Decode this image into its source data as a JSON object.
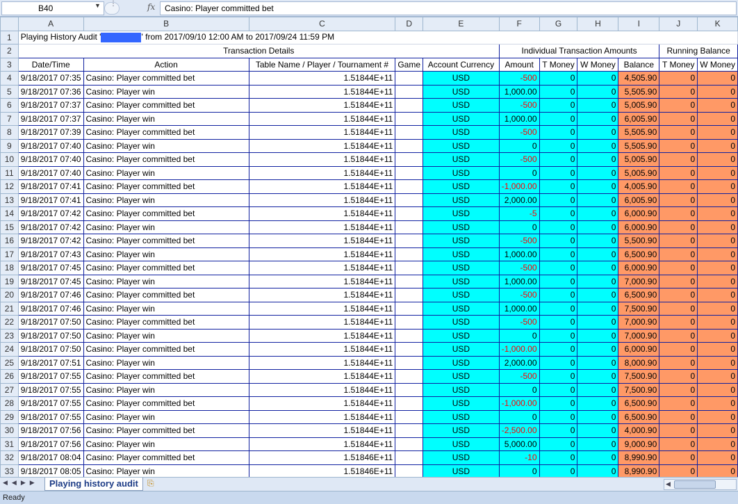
{
  "formula_bar": {
    "name_box": "B40",
    "fx_label": "fx",
    "formula": "Casino: Player committed bet"
  },
  "columns": [
    "A",
    "B",
    "C",
    "D",
    "E",
    "F",
    "G",
    "H",
    "I",
    "J",
    "K"
  ],
  "title": {
    "row": "1",
    "prefix": "Playing History Audit '",
    "suffix": "' from 2017/09/10 12:00 AM to 2017/09/24 11:59 PM"
  },
  "group_headers": {
    "row": "2",
    "transaction_details": "Transaction Details",
    "individual_amounts": "Individual Transaction Amounts",
    "running_balance": "Running Balance"
  },
  "column_headers": {
    "row": "3",
    "date_time": "Date/Time",
    "action": "Action",
    "table_name": "Table Name / Player / Tournament #",
    "game": "Game",
    "account_currency": "Account Currency",
    "amount": "Amount",
    "t_money": "T Money",
    "w_money": "W Money",
    "balance": "Balance",
    "rb_t_money": "T Money",
    "rb_w_money": "W Money"
  },
  "rows": [
    {
      "row": "4",
      "dt": "9/18/2017 07:35",
      "action": "Casino: Player committed bet",
      "table": "1.51844E+11",
      "cur": "USD",
      "amount": "-500",
      "t": "0",
      "w": "0",
      "bal": "4,505.90",
      "bt": "0",
      "bw": "0"
    },
    {
      "row": "5",
      "dt": "9/18/2017 07:36",
      "action": "Casino: Player win",
      "table": "1.51844E+11",
      "cur": "USD",
      "amount": "1,000.00",
      "t": "0",
      "w": "0",
      "bal": "5,505.90",
      "bt": "0",
      "bw": "0"
    },
    {
      "row": "6",
      "dt": "9/18/2017 07:37",
      "action": "Casino: Player committed bet",
      "table": "1.51844E+11",
      "cur": "USD",
      "amount": "-500",
      "t": "0",
      "w": "0",
      "bal": "5,005.90",
      "bt": "0",
      "bw": "0"
    },
    {
      "row": "7",
      "dt": "9/18/2017 07:37",
      "action": "Casino: Player win",
      "table": "1.51844E+11",
      "cur": "USD",
      "amount": "1,000.00",
      "t": "0",
      "w": "0",
      "bal": "6,005.90",
      "bt": "0",
      "bw": "0"
    },
    {
      "row": "8",
      "dt": "9/18/2017 07:39",
      "action": "Casino: Player committed bet",
      "table": "1.51844E+11",
      "cur": "USD",
      "amount": "-500",
      "t": "0",
      "w": "0",
      "bal": "5,505.90",
      "bt": "0",
      "bw": "0"
    },
    {
      "row": "9",
      "dt": "9/18/2017 07:40",
      "action": "Casino: Player win",
      "table": "1.51844E+11",
      "cur": "USD",
      "amount": "0",
      "t": "0",
      "w": "0",
      "bal": "5,505.90",
      "bt": "0",
      "bw": "0"
    },
    {
      "row": "10",
      "dt": "9/18/2017 07:40",
      "action": "Casino: Player committed bet",
      "table": "1.51844E+11",
      "cur": "USD",
      "amount": "-500",
      "t": "0",
      "w": "0",
      "bal": "5,005.90",
      "bt": "0",
      "bw": "0"
    },
    {
      "row": "11",
      "dt": "9/18/2017 07:40",
      "action": "Casino: Player win",
      "table": "1.51844E+11",
      "cur": "USD",
      "amount": "0",
      "t": "0",
      "w": "0",
      "bal": "5,005.90",
      "bt": "0",
      "bw": "0"
    },
    {
      "row": "12",
      "dt": "9/18/2017 07:41",
      "action": "Casino: Player committed bet",
      "table": "1.51844E+11",
      "cur": "USD",
      "amount": "-1,000.00",
      "t": "0",
      "w": "0",
      "bal": "4,005.90",
      "bt": "0",
      "bw": "0"
    },
    {
      "row": "13",
      "dt": "9/18/2017 07:41",
      "action": "Casino: Player win",
      "table": "1.51844E+11",
      "cur": "USD",
      "amount": "2,000.00",
      "t": "0",
      "w": "0",
      "bal": "6,005.90",
      "bt": "0",
      "bw": "0"
    },
    {
      "row": "14",
      "dt": "9/18/2017 07:42",
      "action": "Casino: Player committed bet",
      "table": "1.51844E+11",
      "cur": "USD",
      "amount": "-5",
      "t": "0",
      "w": "0",
      "bal": "6,000.90",
      "bt": "0",
      "bw": "0"
    },
    {
      "row": "15",
      "dt": "9/18/2017 07:42",
      "action": "Casino: Player win",
      "table": "1.51844E+11",
      "cur": "USD",
      "amount": "0",
      "t": "0",
      "w": "0",
      "bal": "6,000.90",
      "bt": "0",
      "bw": "0"
    },
    {
      "row": "16",
      "dt": "9/18/2017 07:42",
      "action": "Casino: Player committed bet",
      "table": "1.51844E+11",
      "cur": "USD",
      "amount": "-500",
      "t": "0",
      "w": "0",
      "bal": "5,500.90",
      "bt": "0",
      "bw": "0"
    },
    {
      "row": "17",
      "dt": "9/18/2017 07:43",
      "action": "Casino: Player win",
      "table": "1.51844E+11",
      "cur": "USD",
      "amount": "1,000.00",
      "t": "0",
      "w": "0",
      "bal": "6,500.90",
      "bt": "0",
      "bw": "0"
    },
    {
      "row": "18",
      "dt": "9/18/2017 07:45",
      "action": "Casino: Player committed bet",
      "table": "1.51844E+11",
      "cur": "USD",
      "amount": "-500",
      "t": "0",
      "w": "0",
      "bal": "6,000.90",
      "bt": "0",
      "bw": "0"
    },
    {
      "row": "19",
      "dt": "9/18/2017 07:45",
      "action": "Casino: Player win",
      "table": "1.51844E+11",
      "cur": "USD",
      "amount": "1,000.00",
      "t": "0",
      "w": "0",
      "bal": "7,000.90",
      "bt": "0",
      "bw": "0"
    },
    {
      "row": "20",
      "dt": "9/18/2017 07:46",
      "action": "Casino: Player committed bet",
      "table": "1.51844E+11",
      "cur": "USD",
      "amount": "-500",
      "t": "0",
      "w": "0",
      "bal": "6,500.90",
      "bt": "0",
      "bw": "0"
    },
    {
      "row": "21",
      "dt": "9/18/2017 07:46",
      "action": "Casino: Player win",
      "table": "1.51844E+11",
      "cur": "USD",
      "amount": "1,000.00",
      "t": "0",
      "w": "0",
      "bal": "7,500.90",
      "bt": "0",
      "bw": "0"
    },
    {
      "row": "22",
      "dt": "9/18/2017 07:50",
      "action": "Casino: Player committed bet",
      "table": "1.51844E+11",
      "cur": "USD",
      "amount": "-500",
      "t": "0",
      "w": "0",
      "bal": "7,000.90",
      "bt": "0",
      "bw": "0"
    },
    {
      "row": "23",
      "dt": "9/18/2017 07:50",
      "action": "Casino: Player win",
      "table": "1.51844E+11",
      "cur": "USD",
      "amount": "0",
      "t": "0",
      "w": "0",
      "bal": "7,000.90",
      "bt": "0",
      "bw": "0"
    },
    {
      "row": "24",
      "dt": "9/18/2017 07:50",
      "action": "Casino: Player committed bet",
      "table": "1.51844E+11",
      "cur": "USD",
      "amount": "-1,000.00",
      "t": "0",
      "w": "0",
      "bal": "6,000.90",
      "bt": "0",
      "bw": "0"
    },
    {
      "row": "25",
      "dt": "9/18/2017 07:51",
      "action": "Casino: Player win",
      "table": "1.51844E+11",
      "cur": "USD",
      "amount": "2,000.00",
      "t": "0",
      "w": "0",
      "bal": "8,000.90",
      "bt": "0",
      "bw": "0"
    },
    {
      "row": "26",
      "dt": "9/18/2017 07:55",
      "action": "Casino: Player committed bet",
      "table": "1.51844E+11",
      "cur": "USD",
      "amount": "-500",
      "t": "0",
      "w": "0",
      "bal": "7,500.90",
      "bt": "0",
      "bw": "0"
    },
    {
      "row": "27",
      "dt": "9/18/2017 07:55",
      "action": "Casino: Player win",
      "table": "1.51844E+11",
      "cur": "USD",
      "amount": "0",
      "t": "0",
      "w": "0",
      "bal": "7,500.90",
      "bt": "0",
      "bw": "0"
    },
    {
      "row": "28",
      "dt": "9/18/2017 07:55",
      "action": "Casino: Player committed bet",
      "table": "1.51844E+11",
      "cur": "USD",
      "amount": "-1,000.00",
      "t": "0",
      "w": "0",
      "bal": "6,500.90",
      "bt": "0",
      "bw": "0"
    },
    {
      "row": "29",
      "dt": "9/18/2017 07:55",
      "action": "Casino: Player win",
      "table": "1.51844E+11",
      "cur": "USD",
      "amount": "0",
      "t": "0",
      "w": "0",
      "bal": "6,500.90",
      "bt": "0",
      "bw": "0"
    },
    {
      "row": "30",
      "dt": "9/18/2017 07:56",
      "action": "Casino: Player committed bet",
      "table": "1.51844E+11",
      "cur": "USD",
      "amount": "-2,500.00",
      "t": "0",
      "w": "0",
      "bal": "4,000.90",
      "bt": "0",
      "bw": "0"
    },
    {
      "row": "31",
      "dt": "9/18/2017 07:56",
      "action": "Casino: Player win",
      "table": "1.51844E+11",
      "cur": "USD",
      "amount": "5,000.00",
      "t": "0",
      "w": "0",
      "bal": "9,000.90",
      "bt": "0",
      "bw": "0"
    },
    {
      "row": "32",
      "dt": "9/18/2017 08:04",
      "action": "Casino: Player committed bet",
      "table": "1.51846E+11",
      "cur": "USD",
      "amount": "-10",
      "t": "0",
      "w": "0",
      "bal": "8,990.90",
      "bt": "0",
      "bw": "0"
    },
    {
      "row": "33",
      "dt": "9/18/2017 08:05",
      "action": "Casino: Player win",
      "table": "1.51846E+11",
      "cur": "USD",
      "amount": "0",
      "t": "0",
      "w": "0",
      "bal": "8,990.90",
      "bt": "0",
      "bw": "0"
    }
  ],
  "sheet_tab": "Playing history audit",
  "status": "Ready",
  "colors": {
    "cyan": "#00ffff",
    "salmon": "#ff9966",
    "negative": "#ff0000"
  }
}
